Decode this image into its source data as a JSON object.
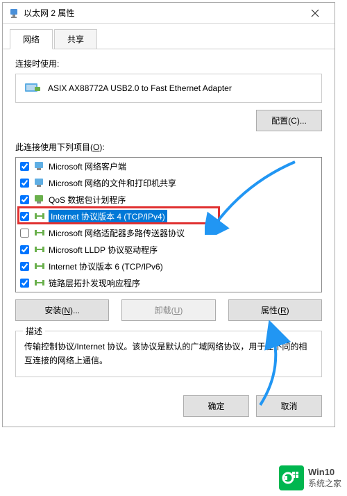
{
  "titlebar": {
    "title": "以太网 2 属性"
  },
  "tabs": {
    "network": "网络",
    "sharing": "共享"
  },
  "labels": {
    "connect_using": "连接时使用:",
    "uses_following": "此连接使用下列项目(O):",
    "description": "描述"
  },
  "adapter": {
    "name": "ASIX AX88772A USB2.0 to Fast Ethernet Adapter"
  },
  "buttons": {
    "configure": "配置(C)...",
    "install": "安装(N)...",
    "uninstall": "卸载(U)",
    "properties": "属性(R)",
    "ok": "确定",
    "cancel": "取消"
  },
  "items": [
    {
      "checked": true,
      "label": "Microsoft 网络客户端",
      "icon": "client"
    },
    {
      "checked": true,
      "label": "Microsoft 网络的文件和打印机共享",
      "icon": "service"
    },
    {
      "checked": true,
      "label": "QoS 数据包计划程序",
      "icon": "service"
    },
    {
      "checked": true,
      "label": "Internet 协议版本 4 (TCP/IPv4)",
      "icon": "protocol",
      "selected": true
    },
    {
      "checked": false,
      "label": "Microsoft 网络适配器多路传送器协议",
      "icon": "protocol"
    },
    {
      "checked": true,
      "label": "Microsoft LLDP 协议驱动程序",
      "icon": "protocol"
    },
    {
      "checked": true,
      "label": "Internet 协议版本 6 (TCP/IPv6)",
      "icon": "protocol"
    },
    {
      "checked": true,
      "label": "链路层拓扑发现响应程序",
      "icon": "protocol"
    }
  ],
  "description_text": "传输控制协议/Internet 协议。该协议是默认的广域网络协议，用于在不同的相互连接的网络上通信。",
  "watermark": {
    "line1": "Win10",
    "line2": "系统之家"
  }
}
